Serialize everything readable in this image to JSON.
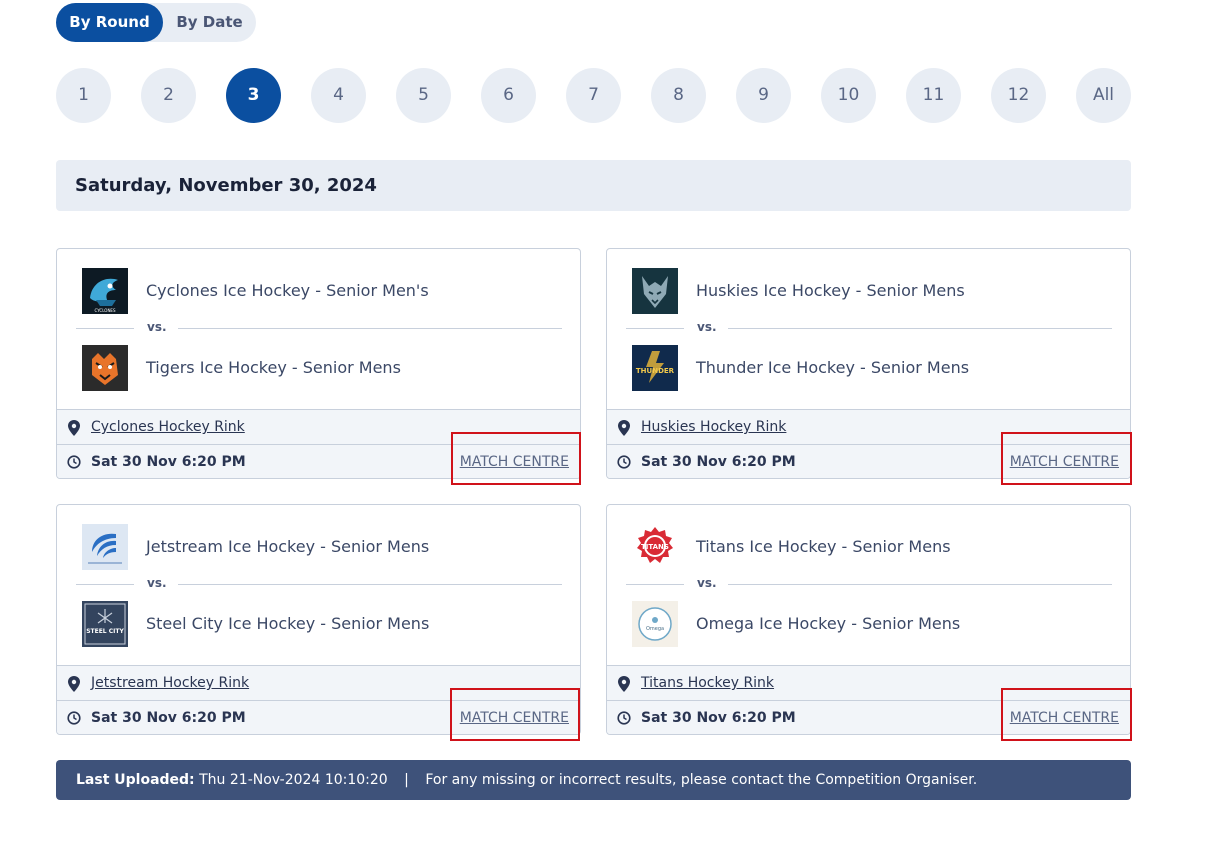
{
  "toggle": {
    "by_round": "By Round",
    "by_date": "By Date"
  },
  "rounds": [
    "1",
    "2",
    "3",
    "4",
    "5",
    "6",
    "7",
    "8",
    "9",
    "10",
    "11",
    "12",
    "All"
  ],
  "active_round": "3",
  "date_heading": "Saturday, November 30, 2024",
  "vs_label": "vs.",
  "matches": [
    {
      "home": "Cyclones Ice Hockey - Senior Men's",
      "away": "Tigers Ice Hockey - Senior Mens",
      "venue": "Cyclones Hockey Rink",
      "time": "Sat 30 Nov  6:20 PM",
      "link": "MATCH CENTRE"
    },
    {
      "home": "Huskies Ice Hockey - Senior Mens",
      "away": "Thunder Ice Hockey - Senior Mens",
      "venue": "Huskies Hockey Rink",
      "time": "Sat 30 Nov  6:20 PM",
      "link": "MATCH CENTRE"
    },
    {
      "home": "Jetstream Ice Hockey - Senior Mens",
      "away": "Steel City Ice Hockey - Senior Mens",
      "venue": "Jetstream Hockey Rink",
      "time": "Sat 30 Nov  6:20 PM",
      "link": "MATCH CENTRE"
    },
    {
      "home": "Titans Ice Hockey - Senior Mens",
      "away": "Omega Ice Hockey - Senior Mens",
      "venue": "Titans Hockey Rink",
      "time": "Sat 30 Nov  6:20 PM",
      "link": "MATCH CENTRE"
    }
  ],
  "logos": {
    "cyclones": "CYCLONES",
    "steel_city": "STEEL CITY",
    "thunder": "THUNDER",
    "titans": "TITANS",
    "omega": "Omega"
  },
  "footer": {
    "label": "Last Uploaded:",
    "timestamp": "Thu 21-Nov-2024 10:10:20",
    "separator": "|",
    "message": "For any missing or incorrect results, please contact the Competition Organiser."
  },
  "colors": {
    "primary": "#0b4fa0",
    "pill_bg": "#e8edf4",
    "footer_bg": "#3e527a",
    "highlight": "#d0121a"
  }
}
